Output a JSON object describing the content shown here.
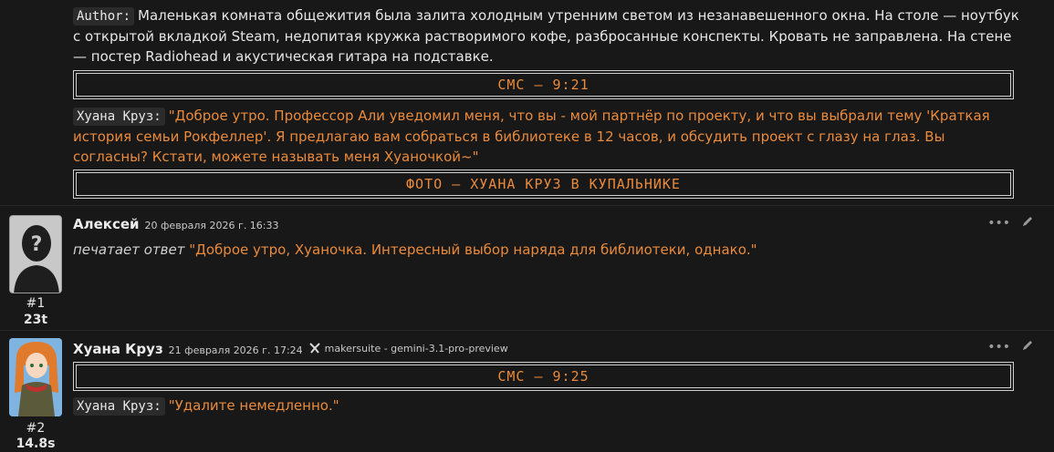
{
  "top_post": {
    "author_tag": "Author:",
    "narration": "Маленькая комната общежития была залита холодным утренним светом из незанавешенного окна. На столе — ноутбук с открытой вкладкой Steam, недопитая кружка растворимого кофе, разбросанные конспекты. Кровать не заправлена. На стене — постер Radiohead и акустическая гитара на подставке.",
    "banner1": "СМС – 9:21",
    "speaker_tag": "Хуана Круз:",
    "speech": "\"Доброе утро. Профессор Али уведомил меня, что вы - мой партнёр по проекту, и что вы выбрали тему 'Краткая история семьи Рокфеллер'. Я предлагаю вам собраться в библиотеке в 12 часов, и обсудить проект с глазу на глаз. Вы согласны? Кстати, можете называть меня Хуаночкой~\"",
    "banner2": "ФОТО – ХУАНА КРУЗ В КУПАЛЬНИКЕ"
  },
  "post1": {
    "author": "Алексей",
    "date": "20 февраля 2026 г. 16:33",
    "num": "#1",
    "tokens": "23t",
    "action_text": "печатает ответ",
    "speech": "\"Доброе утро, Хуаночка. Интересный выбор наряда для библиотеки, однако.\""
  },
  "post2": {
    "author": "Хуана Круз",
    "date": "21 февраля 2026 г. 17:24",
    "model": "makersuite - gemini-3.1-pro-preview",
    "num": "#2",
    "tokens": "14.8s",
    "banner": "СМС – 9:25",
    "speaker_tag": "Хуана Круз:",
    "speech": "\"Удалите немедленно.\""
  },
  "icons": {
    "more": "more-icon",
    "edit": "edit-icon",
    "model": "model-icon"
  },
  "colors": {
    "background": "#181818",
    "accent": "#e98a3c"
  }
}
